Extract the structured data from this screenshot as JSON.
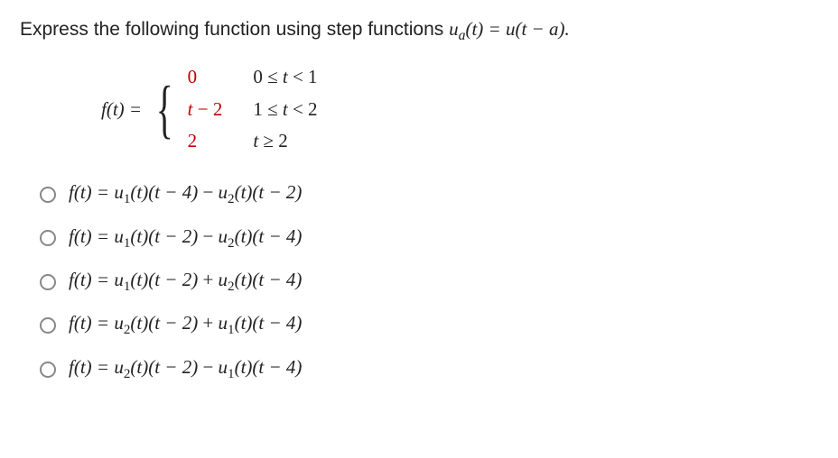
{
  "question": {
    "prefix": "Express the following function using step functions  ",
    "notation_lhs": "u",
    "notation_sub": "a",
    "notation_after_sub": "(t) = u(t − a).",
    "full_render_parts": [
      "Express the following function using step functions  "
    ]
  },
  "piecewise": {
    "lhs": "f(t) = ",
    "case1_expr": "0",
    "case1_cond": "0 ≤ t < 1",
    "case2_expr": "t − 2",
    "case2_cond": "1 ≤ t < 2",
    "case3_expr": "2",
    "case3_cond": "t ≥ 2"
  },
  "options": [
    {
      "lhs": "f(t) = ",
      "term1_u": "u",
      "term1_sub": "1",
      "term1_arg": "(t)(t − 4)",
      "op": " − ",
      "term2_u": "u",
      "term2_sub": "2",
      "term2_arg": "(t)(t − 2)"
    },
    {
      "lhs": "f(t) = ",
      "term1_u": "u",
      "term1_sub": "1",
      "term1_arg": "(t)(t − 2)",
      "op": " − ",
      "term2_u": "u",
      "term2_sub": "2",
      "term2_arg": "(t)(t − 4)"
    },
    {
      "lhs": "f(t) = ",
      "term1_u": "u",
      "term1_sub": "1",
      "term1_arg": "(t)(t − 2)",
      "op": " + ",
      "term2_u": "u",
      "term2_sub": "2",
      "term2_arg": "(t)(t − 4)"
    },
    {
      "lhs": "f(t) = ",
      "term1_u": "u",
      "term1_sub": "2",
      "term1_arg": "(t)(t − 2)",
      "op": " + ",
      "term2_u": "u",
      "term2_sub": "1",
      "term2_arg": "(t)(t − 4)"
    },
    {
      "lhs": "f(t) = ",
      "term1_u": "u",
      "term1_sub": "2",
      "term1_arg": "(t)(t − 2)",
      "op": " − ",
      "term2_u": "u",
      "term2_sub": "1",
      "term2_arg": "(t)(t − 4)"
    }
  ]
}
